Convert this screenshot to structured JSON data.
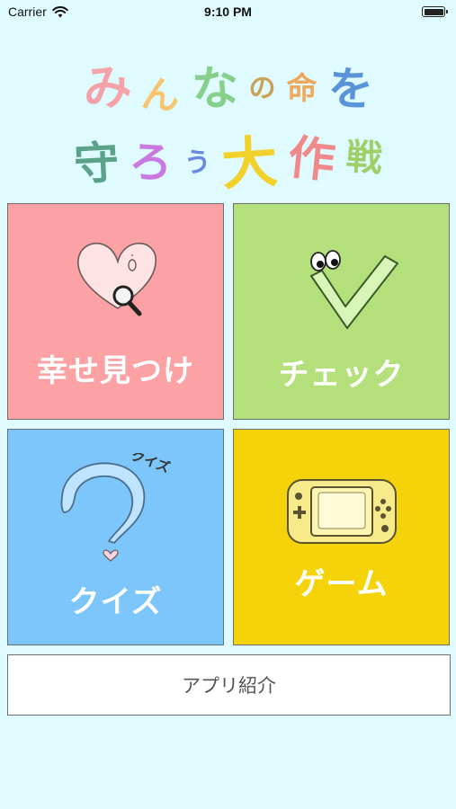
{
  "status_bar": {
    "carrier": "Carrier",
    "time": "9:10 PM",
    "battery_level": 1.0
  },
  "title": {
    "line1": [
      {
        "char": "み",
        "color": "#f4a3a8"
      },
      {
        "char": "ん",
        "color": "#f6c56e"
      },
      {
        "char": "な",
        "color": "#86d08b"
      },
      {
        "char": "の",
        "color": "#c8a25a"
      },
      {
        "char": "命",
        "color": "#f0a85a"
      },
      {
        "char": "を",
        "color": "#5a93d8"
      }
    ],
    "line2": [
      {
        "char": "守",
        "color": "#5aa38a"
      },
      {
        "char": "ろ",
        "color": "#c87ae0"
      },
      {
        "char": "う",
        "color": "#6a88e0"
      },
      {
        "char": "大",
        "color": "#f2d12a"
      },
      {
        "char": "作",
        "color": "#f08a8a"
      },
      {
        "char": "戦",
        "color": "#9ed06a"
      }
    ]
  },
  "tiles": {
    "happiness": {
      "label": "幸せ見つけ",
      "color": "#fca2a5",
      "icon": "heart-magnifier-icon"
    },
    "check": {
      "label": "チェック",
      "color": "#b3e07a",
      "icon": "checkmark-eyes-icon"
    },
    "quiz": {
      "label": "クイズ",
      "color": "#7dc6fb",
      "icon": "question-mark-icon",
      "art_text": "クイズ"
    },
    "game": {
      "label": "ゲーム",
      "color": "#f5d30a",
      "icon": "game-console-icon"
    }
  },
  "about_button": {
    "label": "アプリ紹介"
  }
}
